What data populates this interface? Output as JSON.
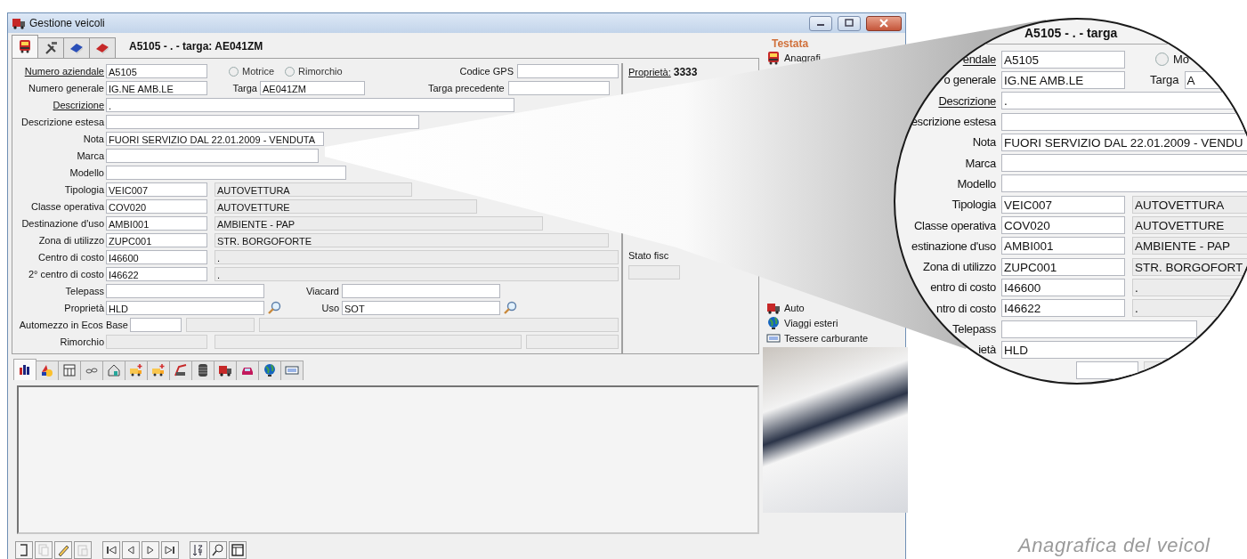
{
  "window": {
    "title": "Gestione veicoli"
  },
  "header": {
    "tabs": [
      {
        "kind": "bus",
        "selected": true
      },
      {
        "kind": "tools",
        "selected": false
      },
      {
        "kind": "book",
        "selected": false
      },
      {
        "kind": "diary",
        "selected": false
      }
    ],
    "title": "A5105 - . - targa: AE041ZM"
  },
  "form": {
    "rows": [
      {
        "kind": "id",
        "label": "Numero aziendale",
        "link": true,
        "value": "A5105",
        "radios": [
          {
            "label": "Motrice",
            "checked": false
          },
          {
            "label": "Rimorchio",
            "checked": false
          }
        ],
        "right_label": "Codice GPS"
      },
      {
        "kind": "plate",
        "label": "Numero generale",
        "link": false,
        "value": "IG.NE AMB.LE",
        "plate_label": "Targa",
        "plate_value": "AE041ZM",
        "right_label": "Targa precedente"
      },
      {
        "kind": "text",
        "label": "Descrizione",
        "link": true,
        "value": "."
      },
      {
        "kind": "text",
        "label": "Descrizione estesa",
        "link": false
      },
      {
        "kind": "text",
        "label": "Nota",
        "link": false,
        "value": "FUORI SERVIZIO DAL 22.01.2009 - VENDUTA"
      },
      {
        "kind": "text",
        "label": "Marca",
        "link": false
      },
      {
        "kind": "text",
        "label": "Modello",
        "link": false
      },
      {
        "kind": "pair",
        "label": "Tipologia",
        "link": false,
        "value": "VEIC007",
        "description": "AUTOVETTURA"
      },
      {
        "kind": "pair",
        "label": "Classe operativa",
        "link": false,
        "value": "COV020",
        "description": "AUTOVETTURE"
      },
      {
        "kind": "pair",
        "label": "Destinazione d'uso",
        "link": false,
        "value": "AMBI001",
        "description": "AMBIENTE - PAP"
      },
      {
        "kind": "pair",
        "label": "Zona di utilizzo",
        "link": false,
        "value": "ZUPC001",
        "description": "STR. BORGOFORTE"
      },
      {
        "kind": "pair",
        "label": "Centro di costo",
        "link": false,
        "value": "I46600",
        "description": "."
      },
      {
        "kind": "pair",
        "label": "2° centro di costo",
        "link": false,
        "value": "I46622",
        "description": "."
      },
      {
        "kind": "dual",
        "label": "Telepass",
        "link": false,
        "lookup": false,
        "second_label": "Viacard"
      },
      {
        "kind": "dual",
        "label": "Proprietà",
        "link": false,
        "lookup": true,
        "value": "HLD",
        "second_label": "Uso",
        "second_value": "SOT"
      },
      {
        "kind": "ecos",
        "label": "Automezzo in Ecos Base",
        "link": false
      },
      {
        "kind": "trailer",
        "label": "Rimorchio",
        "link": false
      }
    ],
    "summary": {
      "label": "Proprietà:",
      "value": "3333",
      "status_label": "Stato fisc"
    }
  },
  "lower_tabs": [
    {
      "kind": "chart",
      "selected": true
    },
    {
      "kind": "shapes",
      "selected": false
    },
    {
      "kind": "calendar",
      "selected": false
    },
    {
      "kind": "glasses",
      "selected": false
    },
    {
      "kind": "house",
      "selected": false
    },
    {
      "kind": "truck",
      "selected": false
    },
    {
      "kind": "truck",
      "selected": false
    },
    {
      "kind": "crane",
      "selected": false
    },
    {
      "kind": "tire",
      "selected": false
    },
    {
      "kind": "lorry",
      "selected": false
    },
    {
      "kind": "car",
      "selected": false
    },
    {
      "kind": "globe",
      "selected": false
    },
    {
      "kind": "keyboard",
      "selected": false
    }
  ],
  "toolbar": [
    {
      "kind": "page",
      "disabled": false
    },
    {
      "kind": "copy",
      "disabled": true
    },
    {
      "kind": "pencil",
      "disabled": false
    },
    {
      "kind": "paste",
      "disabled": true
    },
    {
      "kind": "first",
      "disabled": false
    },
    {
      "kind": "previous",
      "disabled": false
    },
    {
      "kind": "next",
      "disabled": false
    },
    {
      "kind": "last",
      "disabled": false
    },
    {
      "kind": "sort",
      "disabled": false
    },
    {
      "kind": "search",
      "disabled": false
    },
    {
      "kind": "table",
      "disabled": false
    }
  ],
  "side_panel": {
    "heading": "Testata",
    "links_top": [
      {
        "kind": "bus",
        "label": "Anagrafi"
      }
    ],
    "links_bottom": [
      {
        "kind": "lorry",
        "label": "Auto"
      },
      {
        "kind": "globe",
        "label": "Viaggi esteri"
      },
      {
        "kind": "keyboard",
        "label": "Tessere carburante"
      }
    ]
  },
  "lens": {
    "title": "A5105 - . - targa",
    "rows": [
      {
        "kind": "radio",
        "label": "endale",
        "link": true,
        "value": "A5105",
        "radio": {
          "label": "Mo",
          "checked": false
        }
      },
      {
        "kind": "plate",
        "label": "o generale",
        "link": false,
        "value": "IG.NE AMB.LE",
        "plate_label": "Targa",
        "plate_value": "A"
      },
      {
        "kind": "text",
        "label": "Descrizione",
        "link": true,
        "value": "."
      },
      {
        "kind": "text",
        "label": "escrizione estesa",
        "link": false
      },
      {
        "kind": "text",
        "label": "Nota",
        "link": false,
        "value": "FUORI SERVIZIO DAL 22.01.2009 - VENDU"
      },
      {
        "kind": "text",
        "label": "Marca",
        "link": false
      },
      {
        "kind": "text",
        "label": "Modello",
        "link": false
      },
      {
        "kind": "pair",
        "label": "Tipologia",
        "link": false,
        "value": "VEIC007",
        "description": "AUTOVETTURA"
      },
      {
        "kind": "pair",
        "label": "Classe operativa",
        "link": false,
        "value": "COV020",
        "description": "AUTOVETTURE"
      },
      {
        "kind": "pair",
        "label": "estinazione d'uso",
        "link": false,
        "value": "AMBI001",
        "description": "AMBIENTE - PAP"
      },
      {
        "kind": "pair",
        "label": "Zona di utilizzo",
        "link": false,
        "value": "ZUPC001",
        "description": "STR. BORGOFORT"
      },
      {
        "kind": "pair",
        "label": "entro di costo",
        "link": false,
        "value": "I46600",
        "description": "."
      },
      {
        "kind": "pair",
        "label": "ntro di costo",
        "link": false,
        "value": "I46622",
        "description": "."
      },
      {
        "kind": "short",
        "label": "Telepass",
        "link": false
      },
      {
        "kind": "short",
        "label": "ietà",
        "link": false,
        "value": "HLD"
      },
      {
        "kind": "blank"
      }
    ]
  },
  "caption": "Anagrafica del veicol"
}
